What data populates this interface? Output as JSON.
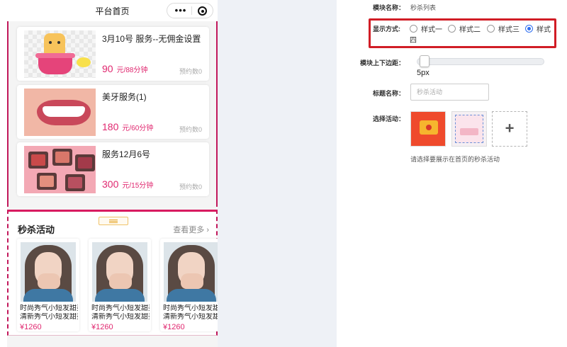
{
  "phone": {
    "nav_title": "平台首页",
    "capsule_more": "•••",
    "services": [
      {
        "title": "3月10号 服务--无佣金设置",
        "price": "90",
        "unit": "元/88分钟",
        "count": "预约数0",
        "image": "toast-illustration"
      },
      {
        "title": "美牙服务(1)",
        "price": "180",
        "unit": "元/60分钟",
        "count": "预约数0",
        "image": "smile-photo"
      },
      {
        "title": "服务12月6号",
        "price": "300",
        "unit": "元/15分钟",
        "count": "预约数0",
        "image": "makeup-palette-photo"
      }
    ],
    "seckill": {
      "title": "秒杀活动",
      "more": "查看更多",
      "items": [
        {
          "line1": "时尚秀气小短发甜美",
          "line2": "清新秀气小短发甜美",
          "price": "¥1260"
        },
        {
          "line1": "时尚秀气小短发甜美",
          "line2": "清新秀气小短发甜美",
          "price": "¥1260"
        },
        {
          "line1": "时尚秀气小短发甜美",
          "line2": "清新秀气小短发甜美",
          "price": "¥1260"
        }
      ]
    }
  },
  "panel": {
    "module_name_label": "模块名称：",
    "module_name_value": "秒杀列表",
    "display_label": "显示方式:",
    "display_options": [
      "样式一",
      "样式二",
      "样式三",
      "样式"
    ],
    "display_option4_wrap": "四",
    "display_selected": "样式四",
    "margin_label": "模块上下边距：",
    "margin_value": "5px",
    "margin_value_num": 5,
    "title_label": "标题名称：",
    "title_placeholder": "秒杀活动",
    "choose_label": "选择活动：",
    "hint": "请选择要展示在首页的秒杀活动",
    "add_icon": "+"
  },
  "colors": {
    "accent_pink": "#e0276f",
    "section_border": "#c2185b",
    "highlight_red": "#d11d26",
    "radio_blue": "#2f6ff0",
    "gap_background": "#eef1f6"
  }
}
